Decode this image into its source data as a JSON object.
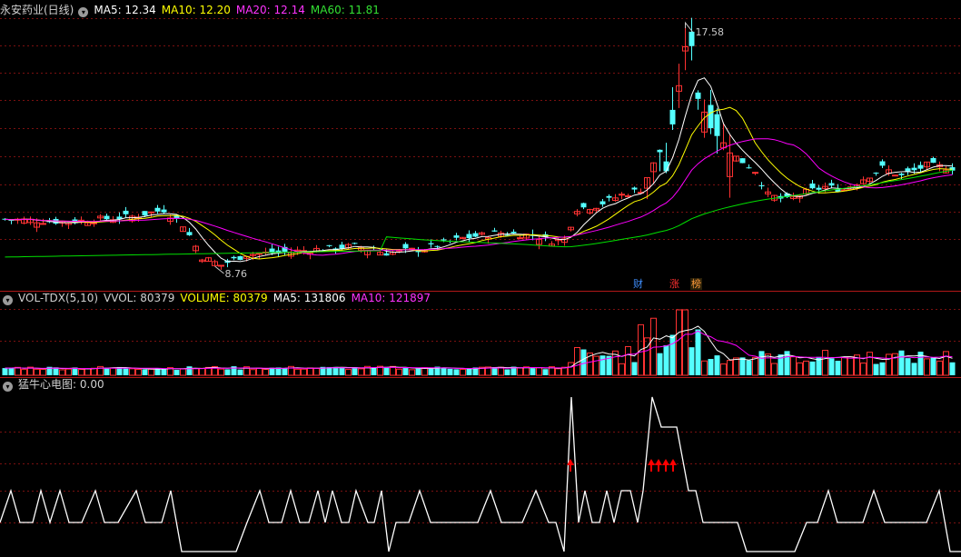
{
  "header_main": {
    "name": "永安药业(日线)",
    "ma5": "MA5: 12.34",
    "ma10": "MA10: 12.20",
    "ma20": "MA20: 12.14",
    "ma60": "MA60: 11.81"
  },
  "header_vol": {
    "name": "VOL-TDX(5,10)",
    "vvol": "VVOL: 80379",
    "volume": "VOLUME: 80379",
    "ma5": "MA5: 131806",
    "ma10": "MA10: 121897"
  },
  "header_ind": {
    "name": "猛牛心电图",
    "value": ": 0.00"
  },
  "price_labels": {
    "high": "17.58",
    "low": "8.76"
  },
  "event_tags": {
    "cai": "财",
    "zhang": "涨",
    "bang": "榜"
  },
  "colors": {
    "up": "#ff3232",
    "down": "#54ffff",
    "ma5": "#ffffff",
    "ma10": "#ffff00",
    "ma20": "#ff00ff",
    "ma60": "#00e000",
    "grid": "#7a1010",
    "frame": "#b01818",
    "signal": "#ff0000"
  },
  "chart_data": [
    {
      "type": "candlestick",
      "title": "永安药业(日线)",
      "labeled_high": 17.58,
      "labeled_low": 8.76,
      "series": [
        "MA5",
        "MA10",
        "MA20",
        "MA60"
      ],
      "latest": {
        "MA5": 12.34,
        "MA10": 12.2,
        "MA20": 12.14,
        "MA60": 11.81
      }
    },
    {
      "type": "bar",
      "title": "VOL-TDX(5,10)",
      "latest": {
        "VVOL": 80379,
        "VOLUME": 80379,
        "MA5": 131806,
        "MA10": 121897
      }
    },
    {
      "type": "line",
      "title": "猛牛心电图",
      "latest": 0.0
    }
  ]
}
